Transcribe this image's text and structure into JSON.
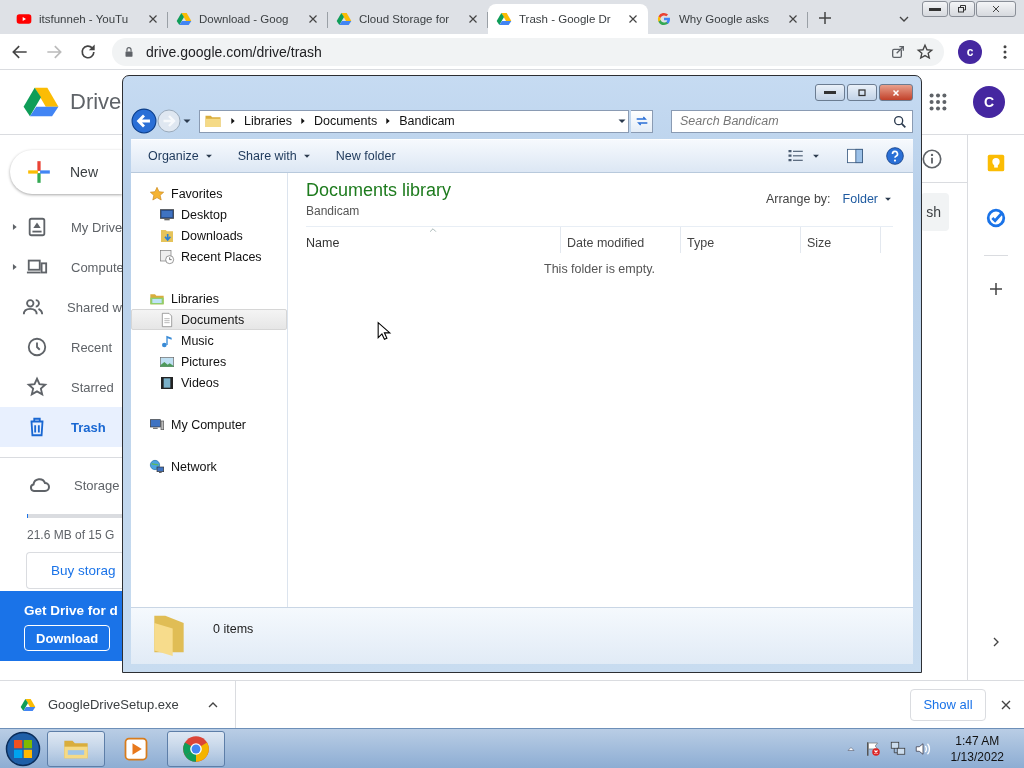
{
  "browser": {
    "tabs": [
      {
        "title": "itsfunneh - YouTu",
        "kind": "youtube",
        "selected": false
      },
      {
        "title": "Download - Goog",
        "kind": "drive",
        "selected": false
      },
      {
        "title": "Cloud Storage for",
        "kind": "drive",
        "selected": false
      },
      {
        "title": "Trash - Google Dr",
        "kind": "drive",
        "selected": true
      },
      {
        "title": "Why Google asks",
        "kind": "google",
        "selected": false
      }
    ],
    "url": "drive.google.com/drive/trash",
    "profile_initial": "c"
  },
  "drive": {
    "product_name": "Drive",
    "new_button": "New",
    "profile_initial": "C",
    "nav": [
      {
        "label": "My Drive",
        "kind": "mydrive",
        "expandable": true,
        "selected": false
      },
      {
        "label": "Compute",
        "kind": "computers",
        "expandable": true,
        "selected": false
      },
      {
        "label": "Shared w",
        "kind": "shared",
        "expandable": false,
        "selected": false
      },
      {
        "label": "Recent",
        "kind": "recent",
        "expandable": false,
        "selected": false
      },
      {
        "label": "Starred",
        "kind": "star",
        "expandable": false,
        "selected": false
      },
      {
        "label": "Trash",
        "kind": "trash",
        "expandable": false,
        "selected": true
      }
    ],
    "storage": {
      "label": "Storage",
      "level": 0.001,
      "usage": "21.6 MB of 15 G",
      "buy_button": "Buy storag"
    },
    "promo": {
      "title": "Get Drive for d",
      "button": "Download"
    },
    "toolbar_button": "sh"
  },
  "explorer": {
    "breadcrumb": [
      "Libraries",
      "Documents",
      "Bandicam"
    ],
    "search_placeholder": "Search Bandicam",
    "commands": [
      {
        "label": "Organize",
        "menu": true
      },
      {
        "label": "Share with",
        "menu": true
      },
      {
        "label": "New folder",
        "menu": false
      }
    ],
    "nav": [
      {
        "label": "Favorites",
        "kind": "favstar",
        "selected": false,
        "children": [
          {
            "label": "Desktop",
            "kind": "desktop",
            "selected": false
          },
          {
            "label": "Downloads",
            "kind": "downloads",
            "selected": false
          },
          {
            "label": "Recent Places",
            "kind": "recentplaces",
            "selected": false
          }
        ]
      },
      {
        "label": "Libraries",
        "kind": "libraries",
        "selected": false,
        "children": [
          {
            "label": "Documents",
            "kind": "documents",
            "selected": true
          },
          {
            "label": "Music",
            "kind": "music",
            "selected": false
          },
          {
            "label": "Pictures",
            "kind": "pictures",
            "selected": false
          },
          {
            "label": "Videos",
            "kind": "videos",
            "selected": false
          }
        ]
      },
      {
        "label": "My Computer",
        "kind": "computer",
        "selected": false
      },
      {
        "label": "Network",
        "kind": "network",
        "selected": false
      }
    ],
    "library_title": "Documents library",
    "library_subtitle": "Bandicam",
    "arrange_label": "Arrange by:",
    "arrange_value": "Folder",
    "columns": [
      {
        "label": "Name",
        "sorted": true
      },
      {
        "label": "Date modified",
        "sorted": false
      },
      {
        "label": "Type",
        "sorted": false
      },
      {
        "label": "Size",
        "sorted": false
      }
    ],
    "empty_message": "This folder is empty.",
    "status": "0 items"
  },
  "downloads": {
    "file": "GoogleDriveSetup.exe",
    "show_all": "Show all"
  },
  "taskbar": {
    "apps": [
      {
        "kind": "explorer",
        "running": true
      },
      {
        "kind": "media",
        "running": false
      },
      {
        "kind": "chrome",
        "running": true
      }
    ],
    "time": "1:47 AM",
    "date": "1/13/2022"
  }
}
